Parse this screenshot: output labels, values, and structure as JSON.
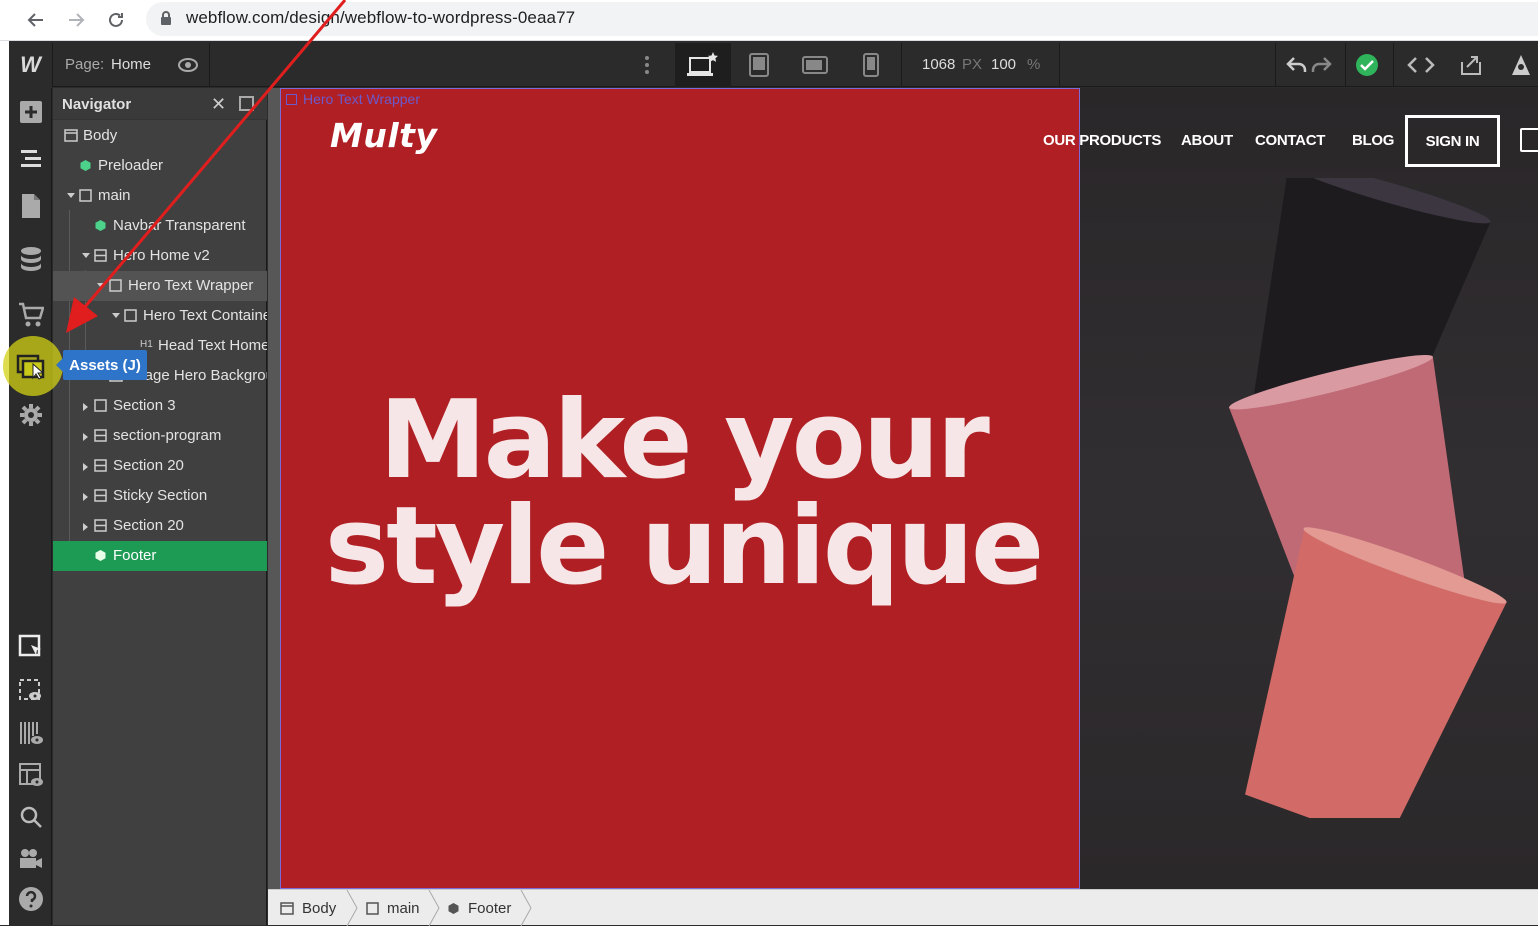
{
  "browser": {
    "url": "webflow.com/design/webflow-to-wordpress-0eaa77"
  },
  "topbar": {
    "logo": "W",
    "page_label": "Page:",
    "page_name": "Home",
    "width_value": "1068",
    "width_unit": "PX",
    "zoom_value": "100",
    "zoom_unit": "%",
    "status_color": "#2fb35b"
  },
  "tooltip": {
    "label": "Assets (J)"
  },
  "navigator": {
    "title": "Navigator",
    "items": [
      {
        "label": "Body",
        "icon": "body-icon"
      },
      {
        "label": "Preloader",
        "icon": "symbol-icon"
      },
      {
        "label": "main",
        "icon": "div-icon"
      },
      {
        "label": "Navbar Transparent",
        "icon": "symbol-icon"
      },
      {
        "label": "Hero Home v2",
        "icon": "section-icon"
      },
      {
        "label": "Hero Text Wrapper",
        "icon": "div-icon"
      },
      {
        "label": "Hero Text Containe",
        "icon": "div-icon"
      },
      {
        "label": "Head Text Home",
        "icon": "heading-icon",
        "prefix": "H1"
      },
      {
        "label": "Image Hero Backgrou",
        "icon": "image-icon"
      },
      {
        "label": "Section 3",
        "icon": "div-icon"
      },
      {
        "label": "section-program",
        "icon": "section-icon"
      },
      {
        "label": "Section 20",
        "icon": "section-icon"
      },
      {
        "label": "Sticky Section",
        "icon": "section-icon"
      },
      {
        "label": "Section 20",
        "icon": "section-icon"
      },
      {
        "label": "Footer",
        "icon": "symbol-icon"
      }
    ]
  },
  "canvas": {
    "selected_tag": "Hero Text Wrapper",
    "brand": "Multy",
    "nav": [
      "OUR PRODUCTS",
      "ABOUT",
      "CONTACT",
      "BLOG"
    ],
    "signin": "SIGN IN",
    "headline_line1": "Make your",
    "headline_line2": "style unique",
    "hero_color": "#b01f23"
  },
  "breadcrumb": [
    {
      "label": "Body",
      "icon": "body-icon"
    },
    {
      "label": "main",
      "icon": "div-icon"
    },
    {
      "label": "Footer",
      "icon": "symbol-icon"
    }
  ]
}
